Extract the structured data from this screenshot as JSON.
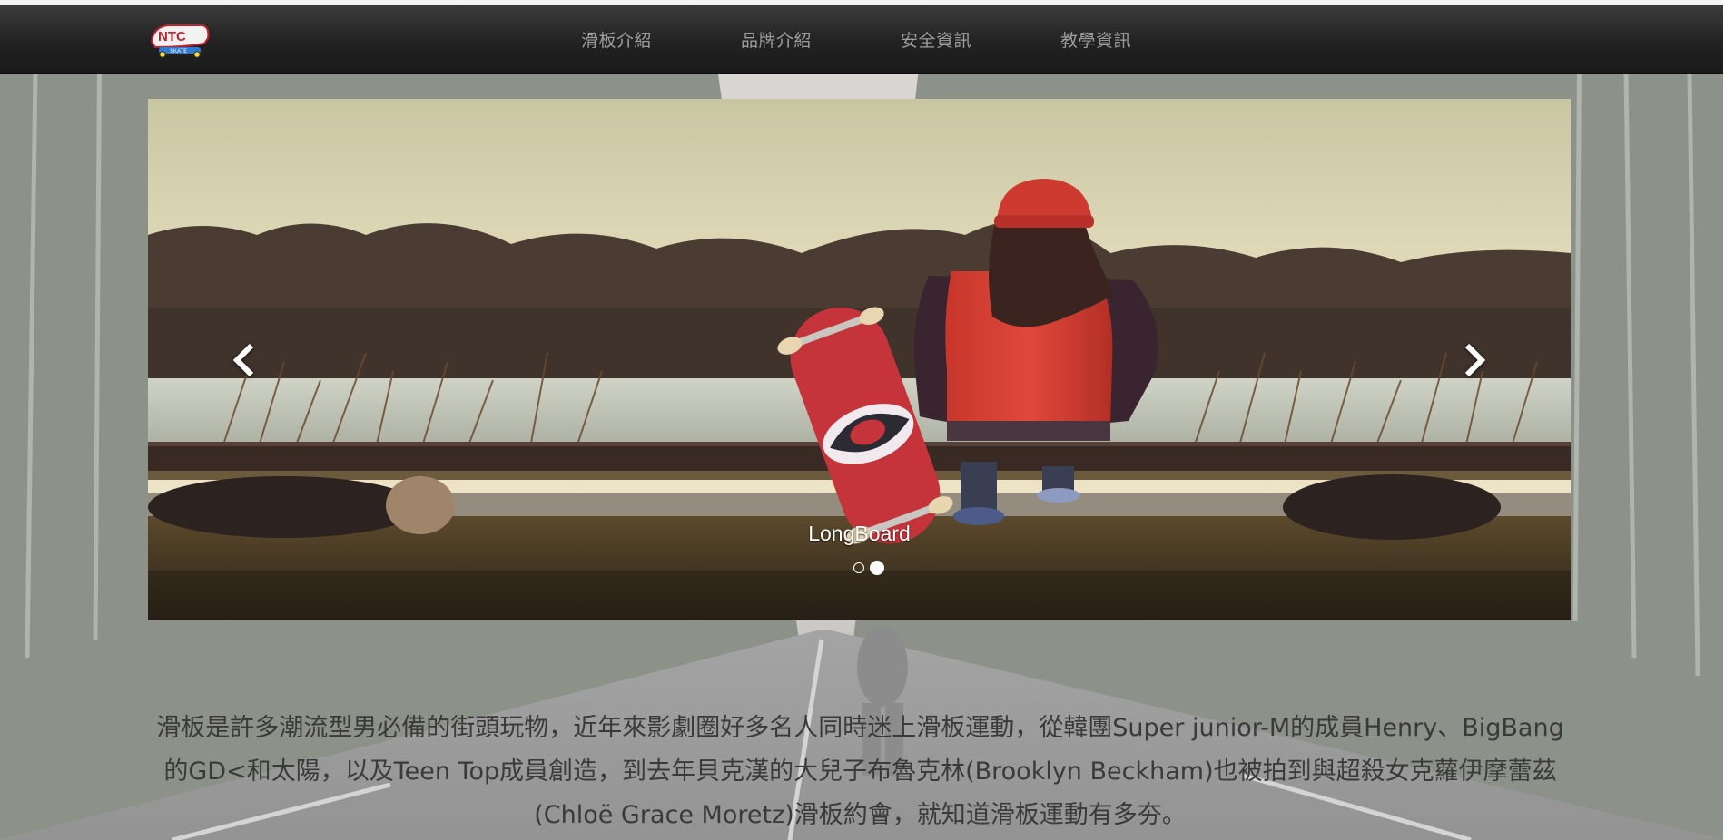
{
  "navbar": {
    "logo": {
      "text": "NTC",
      "subtext": "SKATE",
      "icon": "skateboard-logo-icon"
    },
    "items": [
      {
        "label": "滑板介紹"
      },
      {
        "label": "品牌介紹"
      },
      {
        "label": "安全資訊"
      },
      {
        "label": "教學資訊"
      }
    ]
  },
  "carousel": {
    "caption": "LongBoard",
    "prev_icon": "chevron-left-icon",
    "next_icon": "chevron-right-icon",
    "slide_count": 2,
    "active_slide": 2
  },
  "intro": {
    "text": "滑板是許多潮流型男必備的街頭玩物，近年來影劇圈好多名人同時迷上滑板運動，從韓團Super junior-M的成員Henry、BigBang的GD<和太陽，以及Teen Top成員創造，到去年貝克漢的大兒子布魯克林(Brooklyn Beckham)也被拍到與超殺女克蘿伊摩蕾茲(Chloë Grace Moretz)滑板約會，就知道滑板運動有多夯。"
  },
  "colors": {
    "navbar_bg": "#222222",
    "nav_text": "#9d9d9d",
    "caption_text": "#ffffff",
    "intro_text": "#3a3a3a"
  }
}
